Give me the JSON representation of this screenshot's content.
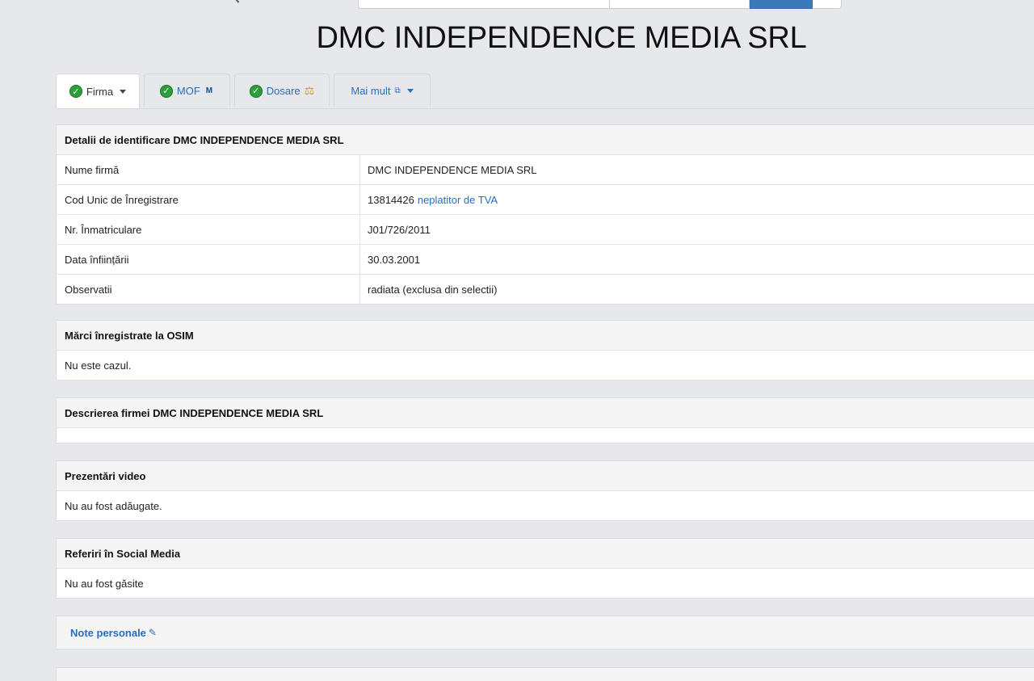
{
  "header": {
    "title": "DMC INDEPENDENCE MEDIA SRL"
  },
  "tabs": [
    {
      "label": "Firma",
      "icon": "check-icon",
      "active": true,
      "has_dropdown": true
    },
    {
      "label": "MOF",
      "icon": "check-icon",
      "extra_icon": "mof-logo-icon"
    },
    {
      "label": "Dosare",
      "icon": "check-icon",
      "extra_icon": "scales-icon"
    },
    {
      "label": "Mai mult",
      "extra_icon": "external-link-icon",
      "has_dropdown": true
    }
  ],
  "identification": {
    "heading": "Detalii de identificare DMC INDEPENDENCE MEDIA SRL",
    "rows": [
      {
        "label": "Nume firmă",
        "value": "DMC INDEPENDENCE MEDIA SRL"
      },
      {
        "label": "Cod Unic de Înregistrare",
        "value": "13814426",
        "link": "neplatitor de TVA"
      },
      {
        "label": "Nr. Înmatriculare",
        "value": "J01/726/2011"
      },
      {
        "label": "Data înființării",
        "value": "30.03.2001"
      },
      {
        "label": "Observatii",
        "value": "radiata (exclusa din selectii)"
      }
    ]
  },
  "osim": {
    "heading": "Mărci înregistrate la OSIM",
    "body": "Nu este cazul."
  },
  "description": {
    "heading": "Descrierea firmei DMC INDEPENDENCE MEDIA SRL",
    "body": ""
  },
  "video": {
    "heading": "Prezentări video",
    "body": "Nu au fost adăugate."
  },
  "social": {
    "heading": "Referiri în Social Media",
    "body": "Nu au fost găsite"
  },
  "notes": {
    "label": "Note personale"
  },
  "colors": {
    "background": "#e7e8ec",
    "link": "#2a6ebb",
    "check": "#2e9e3a",
    "search_button": "#3a7ab8"
  }
}
